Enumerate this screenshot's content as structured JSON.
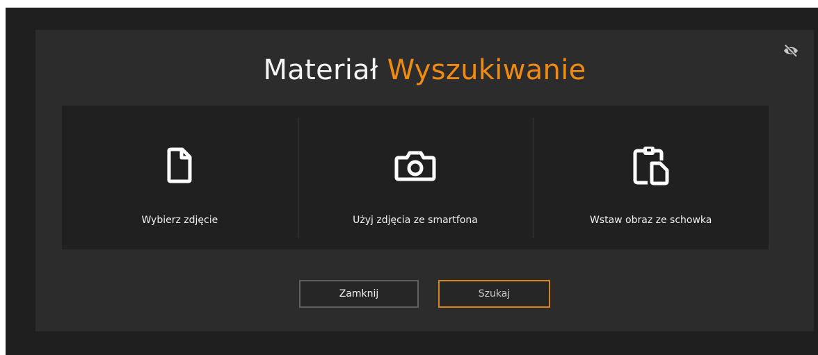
{
  "dialog": {
    "title_part1": "Materiał",
    "title_part2": "Wyszukiwanie",
    "hide_icon": "eye-slash-icon",
    "accent_color": "#ef8a12",
    "options": [
      {
        "icon": "file-icon",
        "label": "Wybierz zdjęcie"
      },
      {
        "icon": "camera-icon",
        "label": "Użyj zdjęcia ze smartfona"
      },
      {
        "icon": "clipboard-paste-icon",
        "label": "Wstaw obraz ze schowka"
      }
    ],
    "buttons": {
      "close_label": "Zamknij",
      "search_label": "Szukaj"
    }
  }
}
